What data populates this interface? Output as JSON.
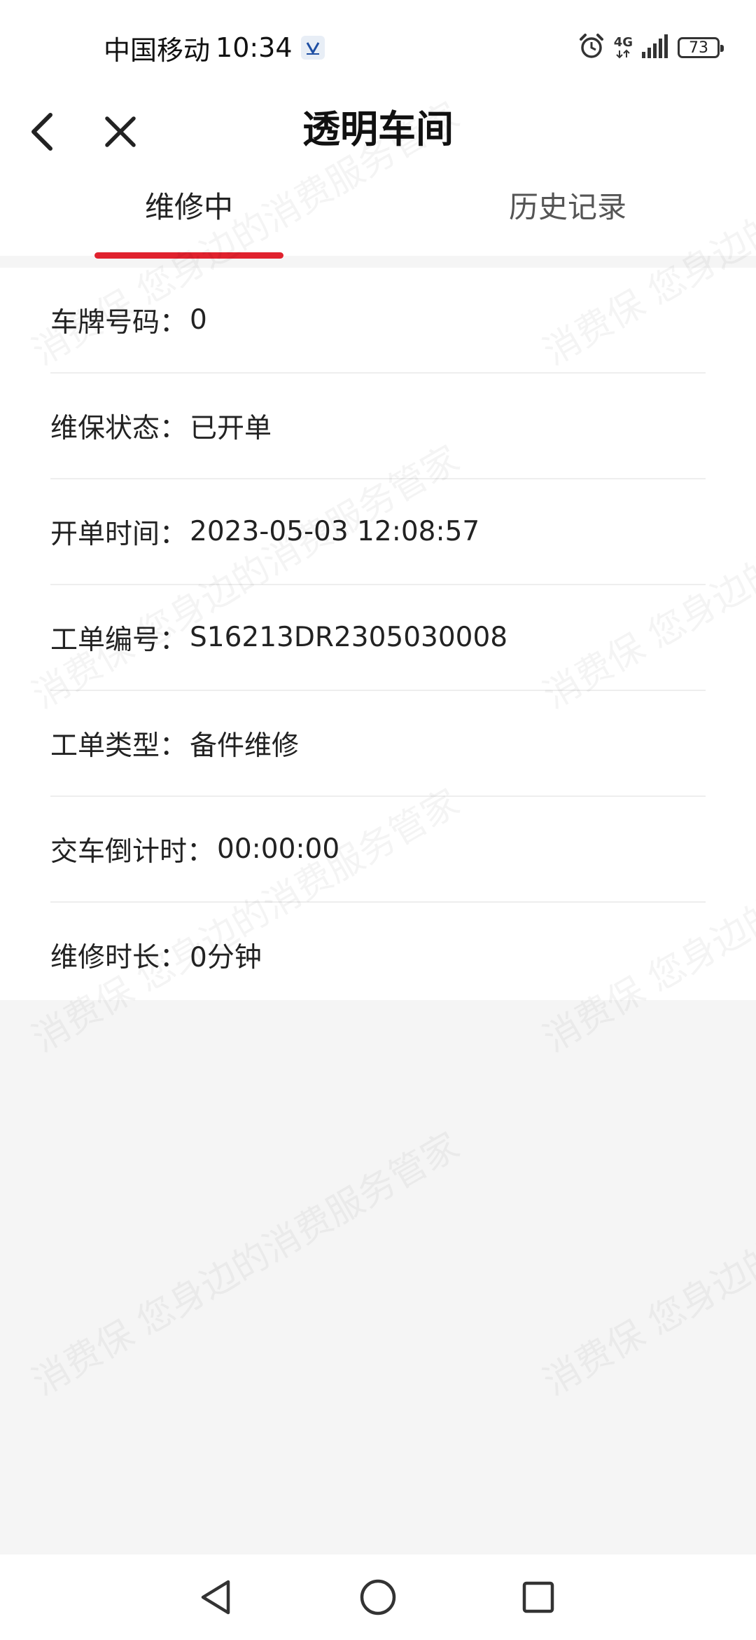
{
  "status_bar": {
    "carrier": "中国移动",
    "time": "10:34",
    "network": "4G",
    "battery": "73",
    "icons": [
      "app-notification-icon",
      "alarm-icon",
      "signal-icon",
      "battery-icon"
    ]
  },
  "header": {
    "title": "透明车间",
    "back_icon": "chevron-left-icon",
    "close_icon": "close-icon"
  },
  "tabs": [
    {
      "label": "维修中",
      "active": true
    },
    {
      "label": "历史记录",
      "active": false
    }
  ],
  "info_rows": [
    {
      "label": "车牌号码：",
      "value": "0"
    },
    {
      "label": "维保状态：",
      "value": "已开单"
    },
    {
      "label": "开单时间：",
      "value": "2023-05-03 12:08:57"
    },
    {
      "label": "工单编号：",
      "value": "S16213DR2305030008"
    },
    {
      "label": "工单类型：",
      "value": "备件维修"
    },
    {
      "label": "交车倒计时：",
      "value": "00:00:00"
    },
    {
      "label": "维修时长：",
      "value": "0分钟"
    }
  ],
  "watermark": {
    "line_a": "消费保 您身边的消费服务管家"
  },
  "nav_bar": {
    "icons": [
      "nav-back-triangle-icon",
      "nav-home-circle-icon",
      "nav-recent-square-icon"
    ]
  },
  "colors": {
    "accent": "#e0222e",
    "background": "#f5f5f5",
    "surface": "#ffffff",
    "text_primary": "#222222",
    "text_secondary": "#555555",
    "divider": "#eeeeee"
  }
}
